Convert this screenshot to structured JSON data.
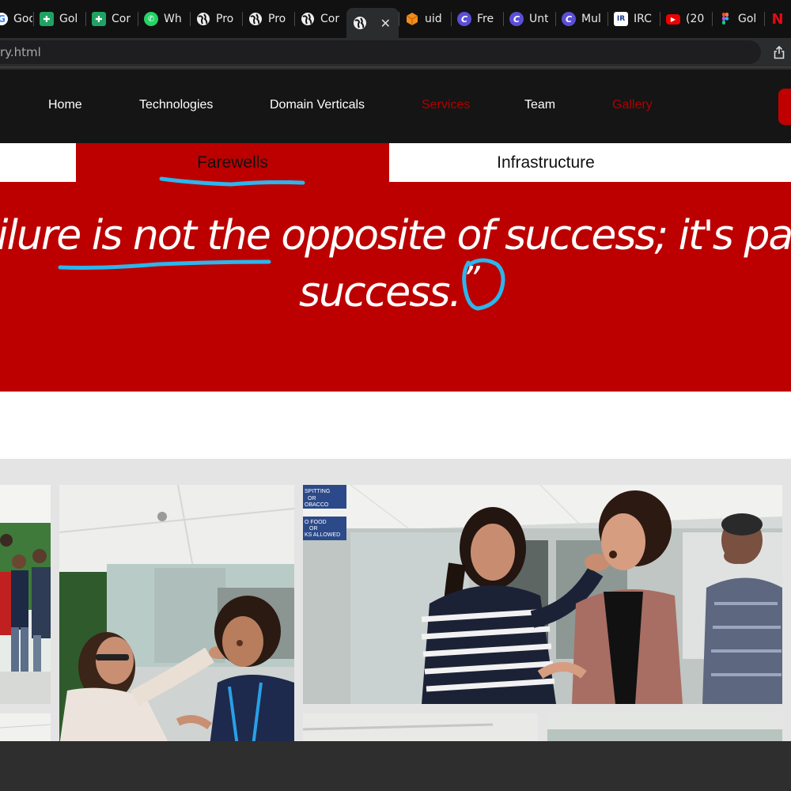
{
  "browser": {
    "tabs": [
      {
        "label": "Goo",
        "icon": "google-icon"
      },
      {
        "label": "Gol",
        "icon": "google-sheets-icon"
      },
      {
        "label": "Cor",
        "icon": "google-sheets-icon"
      },
      {
        "label": "Wh",
        "icon": "whatsapp-icon"
      },
      {
        "label": "Pro",
        "icon": "globe-icon"
      },
      {
        "label": "Pro",
        "icon": "globe-icon"
      },
      {
        "label": "Cor",
        "icon": "globe-icon"
      },
      {
        "label": "",
        "icon": "globe-icon",
        "active": true
      },
      {
        "label": "uid",
        "icon": "box-icon"
      },
      {
        "label": "Fre",
        "icon": "canva-icon"
      },
      {
        "label": "Unt",
        "icon": "canva-icon"
      },
      {
        "label": "Mul",
        "icon": "canva-icon"
      },
      {
        "label": "IRC",
        "icon": "irctc-icon"
      },
      {
        "label": "(20",
        "icon": "youtube-icon"
      },
      {
        "label": "Gol",
        "icon": "figma-icon"
      },
      {
        "label": "",
        "icon": "netflix-icon"
      }
    ],
    "url": "ry.html"
  },
  "site": {
    "nav": {
      "home": "Home",
      "technologies": "Technologies",
      "domain_verticals": "Domain Verticals",
      "services": "Services",
      "team": "Team",
      "gallery": "Gallery"
    },
    "gallery_tabs": {
      "farewells": "Farewells",
      "infrastructure": "Infrastructure"
    },
    "quote": {
      "line1": "ilure is not the opposite of success; it's pa",
      "line2": "success.",
      "mark": "”"
    },
    "colors": {
      "brand_red": "#bc0000",
      "nav_red": "#b00000",
      "annotation_blue": "#2bb6ee"
    }
  }
}
